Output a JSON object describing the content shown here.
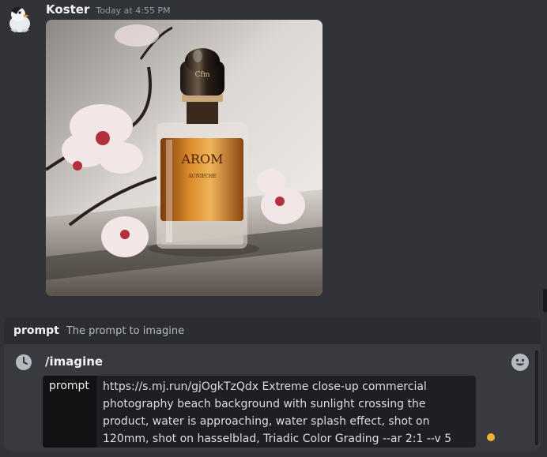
{
  "message": {
    "username": "Koster",
    "timestamp": "Today at 4:55 PM",
    "avatar_icon": "penguin-avatar",
    "attachment": {
      "bottle_label": "AROM",
      "bottle_sublabel": "AUNIECHE",
      "cap_text": "Cfm"
    }
  },
  "hint": {
    "option_name": "prompt",
    "option_description": "The prompt to imagine"
  },
  "composer": {
    "command": "/imagine",
    "option_label": "prompt",
    "option_value": "https://s.mj.run/gjOgkTzQdx Extreme close-up commercial photography beach background with sunlight crossing the product, water is approaching, water splash effect, shot on 120mm, shot on hasselblad, Triadic Color Grading --ar 2:1 --v 5",
    "icons": [
      "clock-icon",
      "emoji-icon"
    ],
    "status_color": "#f0b232"
  },
  "colors": {
    "background": "#313338",
    "hint_bar": "#2b2d31",
    "composer": "#383a40",
    "option_pill": "#1e1f22"
  }
}
